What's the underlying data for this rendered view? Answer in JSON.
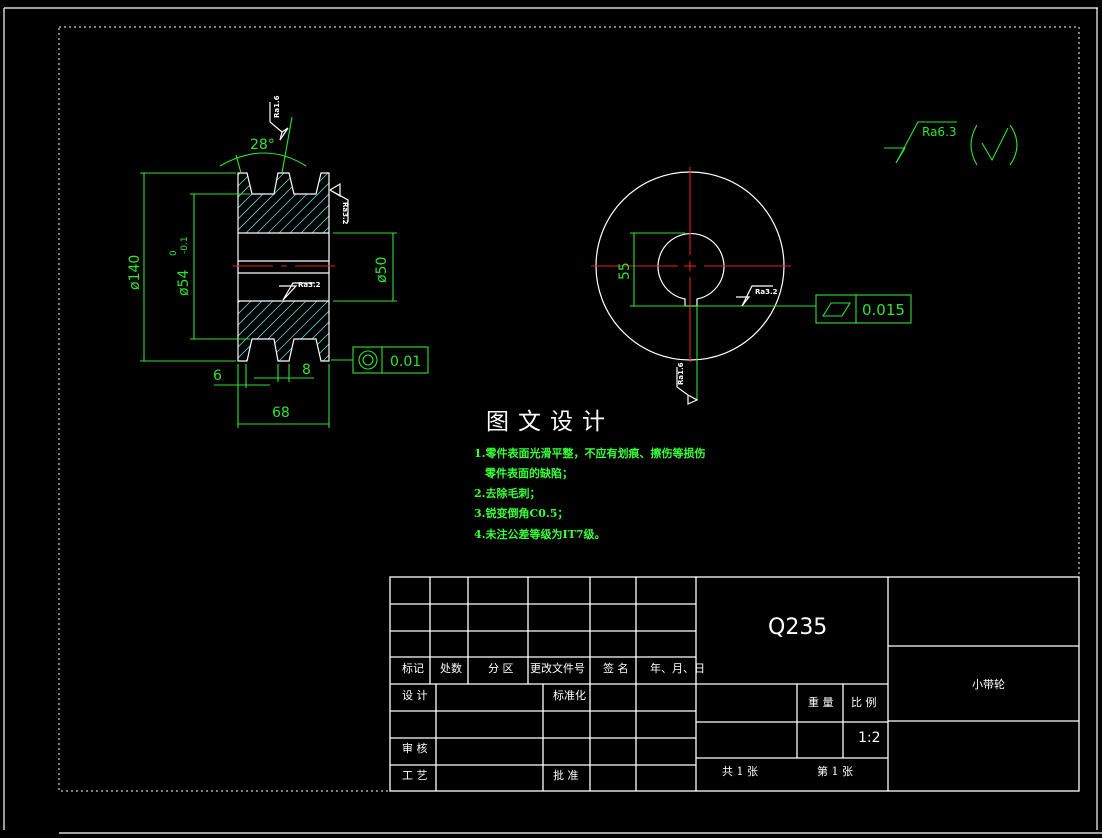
{
  "drawing": {
    "heading": "图文设计",
    "notes": [
      "1.零件表面光滑平整，不应有划痕、擦伤等损伤",
      "零件表面的缺陷；",
      "2.去除毛刺；",
      "3.锐变倒角C0.5；",
      "4.未注公差等级为IT7级。"
    ],
    "general_roughness": {
      "label": "Ra6.3"
    },
    "section_view": {
      "dims": {
        "outer_dia": "ø140",
        "groove_dia": "ø54",
        "groove_tol_upper": "0",
        "groove_tol_lower": "-0.1",
        "bore_dia": "ø50",
        "angle": "28°",
        "width": "68",
        "edge": "6",
        "pitch": "8"
      },
      "roughness": [
        "Ra1.6",
        "Ra3.2",
        "Ra3.2"
      ],
      "coaxiality": {
        "symbol": "coaxiality-icon",
        "tolerance": "0.01"
      }
    },
    "end_view": {
      "dims": {
        "keyway_depth": "55"
      },
      "roughness": [
        "Ra3.2",
        "Ra1.6"
      ],
      "flatness": {
        "symbol": "flatness-icon",
        "tolerance": "0.015"
      }
    },
    "colors": {
      "background": "#000000",
      "geometry": "#ffffff",
      "dimension": "#2ee52e",
      "centerline": "#e02020",
      "hatch": "#5fd0d0"
    }
  },
  "title_block": {
    "material": "Q235",
    "part_name": "小带轮",
    "header_row": [
      "标记",
      "处数",
      "分 区",
      "更改文件号",
      "签 名",
      "年、月、日"
    ],
    "design": "设 计",
    "standardize": "标准化",
    "review": "审 核",
    "process": "工 艺",
    "approve": "批 准",
    "weight_label": "重 量",
    "scale_label": "比 例",
    "scale_value": "1:2",
    "sheets_total": "共 1 张",
    "sheet_no": "第 1 张"
  }
}
